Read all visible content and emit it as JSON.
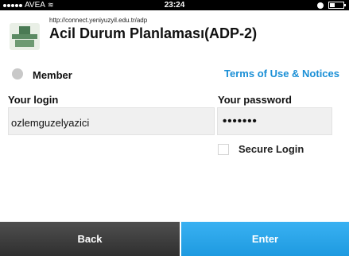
{
  "status_bar": {
    "carrier": "AVEA",
    "time": "23:24"
  },
  "header": {
    "url": "http://connect.yeniyuzyil.edu.tr/adp",
    "title": "Acil Durum Planlaması(ADP-2)"
  },
  "member": {
    "label": "Member"
  },
  "terms_link": "Terms of Use & Notices",
  "login": {
    "label": "Your login",
    "value": "ozlemguzelyazici"
  },
  "password": {
    "label": "Your password",
    "value": "•••••••"
  },
  "secure_login": {
    "label": "Secure Login",
    "checked": false
  },
  "buttons": {
    "back": "Back",
    "enter": "Enter"
  },
  "colors": {
    "accent": "#1a8fd6",
    "enter_button": "#2aa5ea",
    "back_button": "#3b3b3b"
  }
}
